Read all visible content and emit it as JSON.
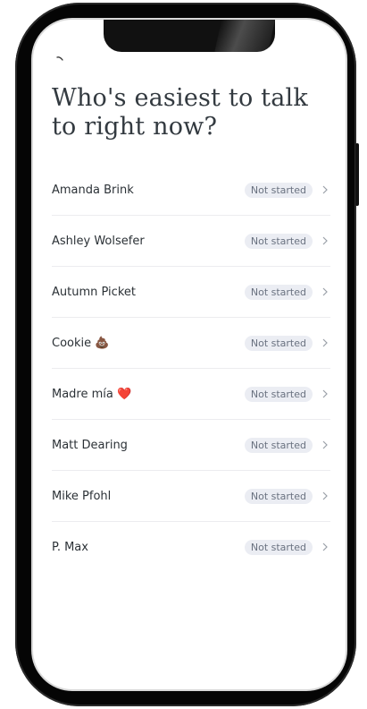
{
  "screen": {
    "title": "Who's easiest to talk to right now?",
    "back_icon": "chevron-left-icon"
  },
  "contacts": [
    {
      "name": "Amanda Brink",
      "status": "Not started"
    },
    {
      "name": "Ashley Wolsefer",
      "status": "Not started"
    },
    {
      "name": "Autumn Picket",
      "status": "Not started"
    },
    {
      "name": "Cookie 💩",
      "status": "Not started"
    },
    {
      "name": "Madre mía ❤️",
      "status": "Not started"
    },
    {
      "name": "Matt Dearing",
      "status": "Not started"
    },
    {
      "name": "Mike Pfohl",
      "status": "Not started"
    },
    {
      "name": "P. Max",
      "status": "Not started"
    }
  ],
  "colors": {
    "frame": "#050505",
    "title": "#333a40",
    "badge_bg": "#ebedf3",
    "badge_text": "#6a7280",
    "divider": "#ececef"
  }
}
